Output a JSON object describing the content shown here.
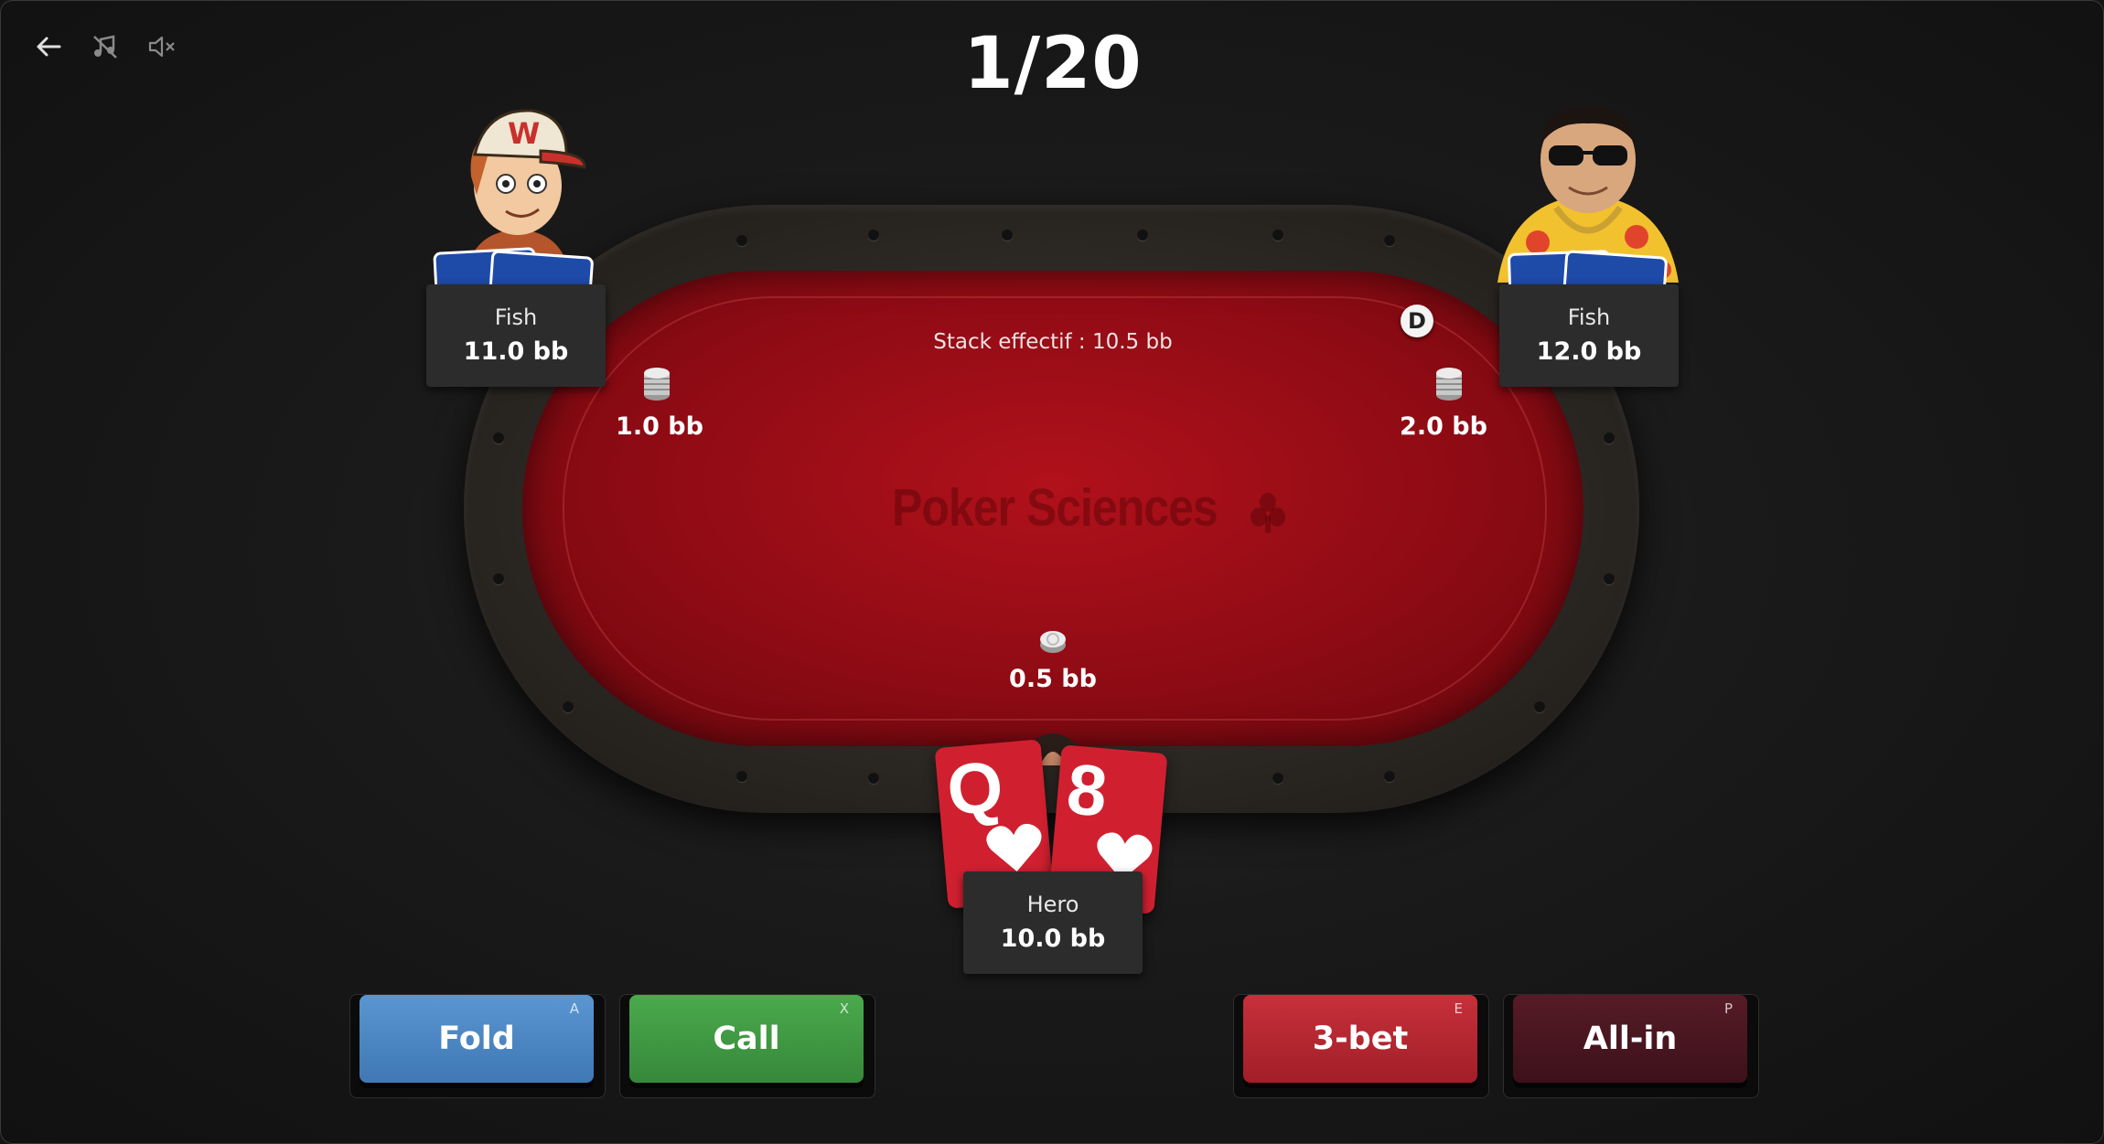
{
  "header": {
    "counter": "1/20"
  },
  "toolbar": {
    "back_icon": "arrow-left-icon",
    "music_icon": "music-off-icon",
    "sound_icon": "volume-mute-icon"
  },
  "table": {
    "stack_effectif": "Stack effectif : 10.5 bb",
    "watermark": "Poker Sciences",
    "dealer_label": "D",
    "felt_color": "#9e0d17"
  },
  "players": {
    "left": {
      "name": "Fish",
      "stack": "11.0 bb",
      "bet": "1.0 bb"
    },
    "right": {
      "name": "Fish",
      "stack": "12.0 bb",
      "bet": "2.0 bb"
    },
    "hero": {
      "name": "Hero",
      "stack": "10.0 bb",
      "bet": "0.5 bb"
    }
  },
  "hero_cards": [
    {
      "rank": "Q",
      "suit": "hearts"
    },
    {
      "rank": "8",
      "suit": "hearts"
    }
  ],
  "actions": [
    {
      "label": "Fold",
      "key": "A",
      "color": "#4a86c2"
    },
    {
      "label": "Call",
      "key": "X",
      "color": "#3f9a42"
    },
    {
      "label": "3-bet",
      "key": "E",
      "color": "#b8262f"
    },
    {
      "label": "All-in",
      "key": "P",
      "color": "#4a1620"
    }
  ]
}
